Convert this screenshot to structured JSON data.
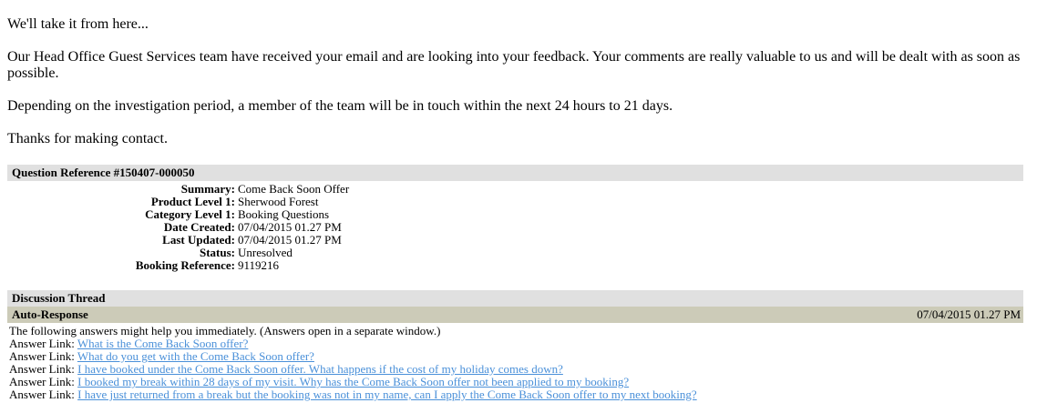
{
  "intro": {
    "heading": "We'll take it from here...",
    "paragraph1": "Our Head Office Guest Services team have received your email and are looking into your feedback. Your comments are really valuable to us and will be dealt with as soon as possible.",
    "paragraph2": "Depending on the investigation period, a member of the team will be in touch within the next 24 hours to 21 days.",
    "paragraph3": "Thanks for making contact."
  },
  "question": {
    "reference_title": "Question Reference #150407-000050",
    "fields": [
      {
        "label": "Summary:",
        "value": "Come Back Soon Offer"
      },
      {
        "label": "Product Level 1:",
        "value": "Sherwood Forest"
      },
      {
        "label": "Category Level 1:",
        "value": "Booking Questions"
      },
      {
        "label": "Date Created:",
        "value": "07/04/2015 01.27 PM"
      },
      {
        "label": "Last Updated:",
        "value": "07/04/2015 01.27 PM"
      },
      {
        "label": "Status:",
        "value": "Unresolved"
      },
      {
        "label": "Booking Reference:",
        "value": "9119216"
      }
    ]
  },
  "thread": {
    "title": "Discussion Thread",
    "auto_response": {
      "title": "Auto-Response",
      "date": "07/04/2015 01.27 PM",
      "intro": "The following answers might help you immediately. (Answers open in a separate window.)",
      "link_prefix": "Answer Link:",
      "links": [
        "What is the Come Back Soon offer?",
        "What do you get with the Come Back Soon offer?",
        "I have booked under the Come Back Soon offer. What happens if the cost of my holiday comes down?",
        "I booked my break within 28 days of my visit. Why has the Come Back Soon offer not been applied to my booking?",
        "I have just returned from a break but the booking was not in my name, can I apply the Come Back Soon offer to my next booking?"
      ]
    }
  },
  "colors": {
    "section_header_bg": "#e0e0e0",
    "auto_response_bg": "#cccbb8",
    "link": "#4a90d9"
  }
}
